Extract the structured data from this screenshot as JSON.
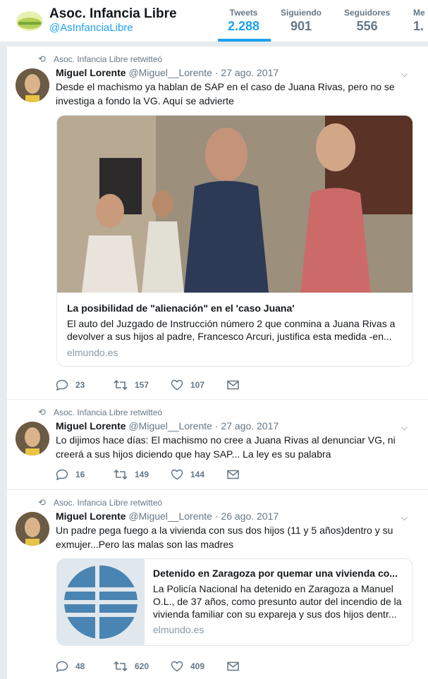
{
  "profile": {
    "name": "Asoc. Infancia Libre",
    "handle": "@AsInfanciaLibre"
  },
  "stats": [
    {
      "label": "Tweets",
      "value": "2.288",
      "active": true
    },
    {
      "label": "Siguiendo",
      "value": "901",
      "active": false
    },
    {
      "label": "Seguidores",
      "value": "556",
      "active": false
    },
    {
      "label": "Me",
      "value": "1.",
      "active": false
    }
  ],
  "tweets": [
    {
      "retweet_text": "Asoc. Infancia Libre retwitteó",
      "author_name": "Miguel Lorente",
      "author_handle": "@Miguel__Lorente",
      "date": "· 27 ago. 2017",
      "text": "Desde el machismo ya hablan de SAP en el caso de Juana Rivas, pero no se investiga a fondo la VG. Aquí se advierte",
      "card": {
        "title": "La posibilidad de \"alienación\" en el 'caso Juana'",
        "description": "El auto del Juzgado de Instrucción número 2 que conmina a Juana Rivas a devolver a sus hijos al padre, Francesco Arcuri, justifica esta medida -en...",
        "domain": "elmundo.es"
      },
      "replies": "23",
      "retweets": "157",
      "likes": "107"
    },
    {
      "retweet_text": "Asoc. Infancia Libre retwitteó",
      "author_name": "Miguel Lorente",
      "author_handle": "@Miguel__Lorente",
      "date": "· 27 ago. 2017",
      "text": "Lo dijimos hace días: El machismo no cree a Juana Rivas al denunciar VG, ni creerá a sus hijos diciendo que hay SAP... La ley es su palabra",
      "replies": "16",
      "retweets": "149",
      "likes": "144"
    },
    {
      "retweet_text": "Asoc. Infancia Libre retwitteó",
      "author_name": "Miguel Lorente",
      "author_handle": "@Miguel__Lorente",
      "date": "· 26 ago. 2017",
      "text": "Un padre pega fuego a la vivienda con sus dos hijos (11 y 5 años)dentro y su exmujer...Pero las malas son las madres",
      "card": {
        "title": "Detenido en Zaragoza por quemar una vivienda co...",
        "description": "La Policía Nacional ha detenido en Zaragoza a Manuel O.L., de 37 años, como presunto autor del incendio de la vivienda familiar con su expareja y sus dos hijos dentr...",
        "domain": "elmundo.es"
      },
      "replies": "48",
      "retweets": "620",
      "likes": "409"
    }
  ]
}
